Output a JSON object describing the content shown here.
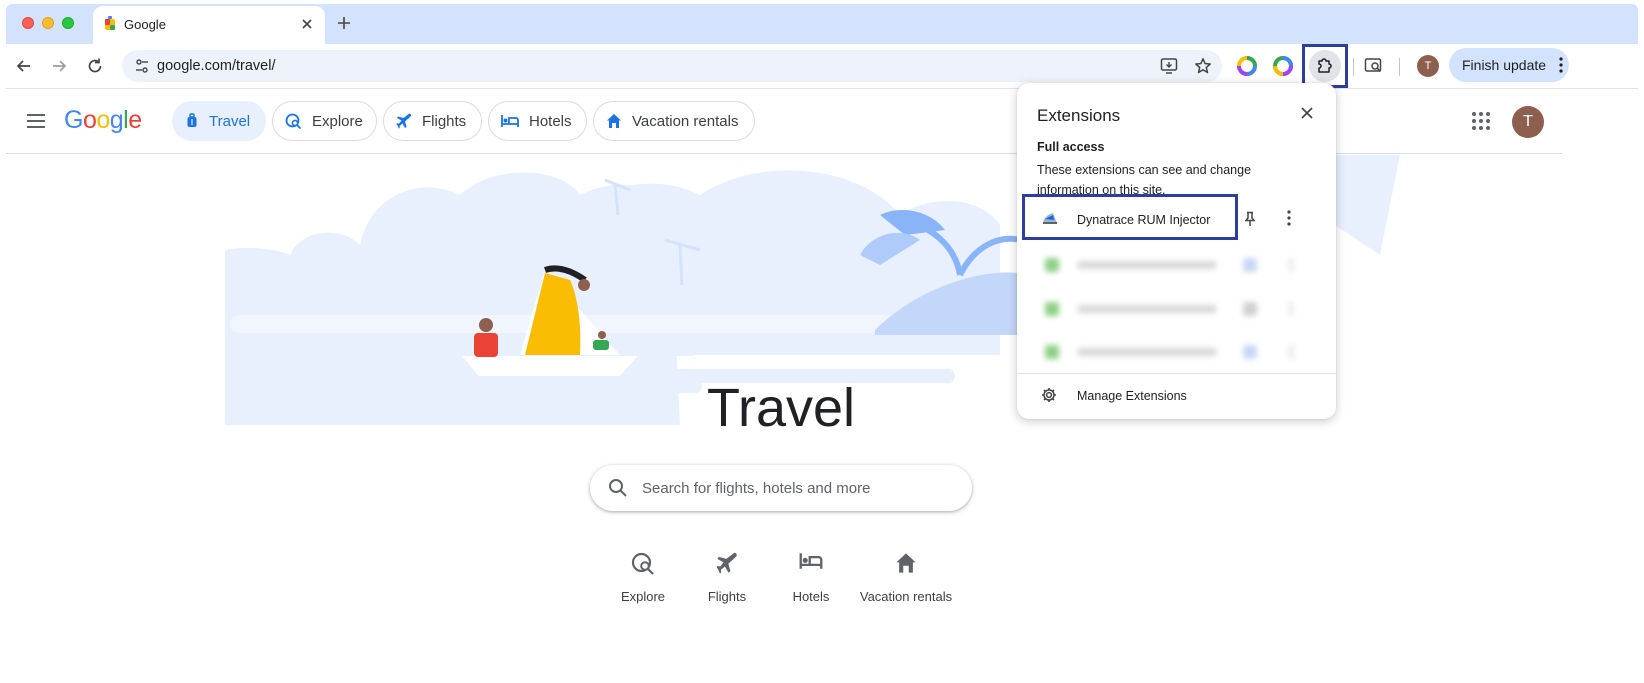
{
  "browser": {
    "tab": {
      "title": "Google",
      "close_icon": "close-icon"
    },
    "new_tab_icon": "plus-icon",
    "url": "google.com/travel/",
    "finish_update_label": "Finish update",
    "profile_initial": "T"
  },
  "header": {
    "logo_letters": [
      {
        "ch": "G",
        "color": "#4285f4"
      },
      {
        "ch": "o",
        "color": "#ea4335"
      },
      {
        "ch": "o",
        "color": "#fbbc04"
      },
      {
        "ch": "g",
        "color": "#4285f4"
      },
      {
        "ch": "l",
        "color": "#34a853"
      },
      {
        "ch": "e",
        "color": "#ea4335"
      }
    ],
    "chips": [
      {
        "label": "Travel",
        "icon": "travel-icon",
        "active": true
      },
      {
        "label": "Explore",
        "icon": "explore-icon",
        "active": false
      },
      {
        "label": "Flights",
        "icon": "flight-icon",
        "active": false
      },
      {
        "label": "Hotels",
        "icon": "hotel-icon",
        "active": false
      },
      {
        "label": "Vacation rentals",
        "icon": "home-icon",
        "active": false
      }
    ],
    "avatar_initial": "T"
  },
  "main": {
    "title": "Travel",
    "search_placeholder": "Search for flights, hotels and more",
    "quick_links": [
      {
        "label": "Explore",
        "icon": "explore-icon"
      },
      {
        "label": "Flights",
        "icon": "flight-icon"
      },
      {
        "label": "Hotels",
        "icon": "hotel-icon"
      },
      {
        "label": "Vacation rentals",
        "icon": "home-icon"
      }
    ]
  },
  "extensions_popup": {
    "title": "Extensions",
    "section_title": "Full access",
    "section_desc": "These extensions can see and change information on this site.",
    "extension_name": "Dynatrace RUM Injector",
    "manage_label": "Manage Extensions"
  },
  "colors": {
    "accent": "#1a73e8",
    "tabstrip": "#d3e3fd",
    "highlight_box": "#2e3e9f"
  }
}
